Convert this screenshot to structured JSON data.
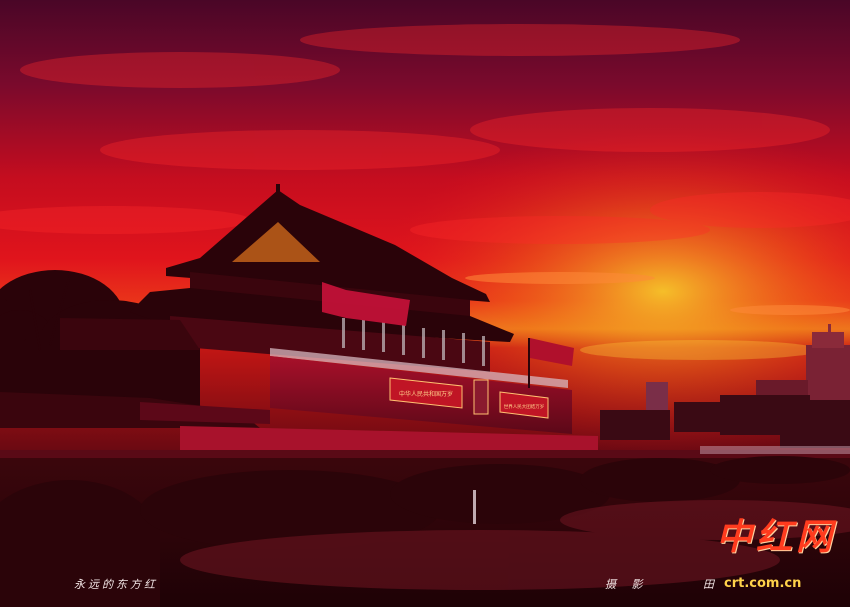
{
  "photo": {
    "subject": "天安门",
    "palette": {
      "sky_top": "#55082a",
      "sky_mid": "#d20f1e",
      "horizon_glow": "#f2b020",
      "silhouette": "#2a0309",
      "ground": "#3a070c"
    }
  },
  "banners": {
    "left_slogan": "中华人民共和国万岁",
    "right_slogan": "世界人民大团结万岁"
  },
  "captions": {
    "title": "永远的东方红",
    "credit_label": "摄 影",
    "photographer": "田"
  },
  "watermark": {
    "logo_text": "中红网",
    "url": "crt.com.cn",
    "logo_color": "#ff3b1e",
    "url_color": "#ffd24a"
  }
}
